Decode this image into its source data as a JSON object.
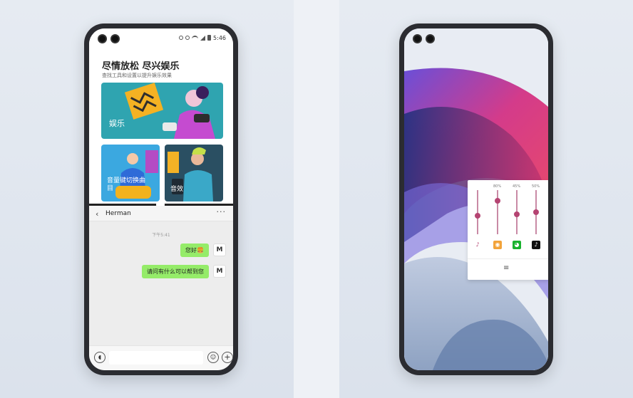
{
  "left_phone": {
    "status": {
      "time": "5:46"
    },
    "entertainment": {
      "title": "尽情放松 尽兴娱乐",
      "subtitle": "查找工具和设置以提升娱乐效果",
      "card_main_label": "娱乐",
      "card_a_label": "音量键切换曲目",
      "card_b_label": "音效"
    },
    "chat": {
      "contact_name": "Herman",
      "more_label": "···",
      "timestamp": "下午5:41",
      "messages": [
        {
          "text": "您好🍔"
        },
        {
          "text": "请问有什么可以帮到您"
        }
      ],
      "avatar_letter": "M",
      "input_value": ""
    }
  },
  "right_phone": {
    "equalizer": {
      "levels": [
        {
          "label": "",
          "percent": 40,
          "icon": "music-note-icon",
          "glyph": "♪",
          "color": "#ffffff"
        },
        {
          "label": "80%",
          "percent": 80,
          "icon": "weibo-icon",
          "glyph": "◉",
          "color": "#f2a33a"
        },
        {
          "label": "45%",
          "percent": 45,
          "icon": "wechat-icon",
          "glyph": "◕",
          "color": "#19b22e"
        },
        {
          "label": "50%",
          "percent": 50,
          "icon": "tiktok-icon",
          "glyph": "♪",
          "color": "#111111"
        }
      ]
    }
  },
  "colors": {
    "chat_bubble": "#95ec69",
    "slider_knob": "#b54472"
  }
}
